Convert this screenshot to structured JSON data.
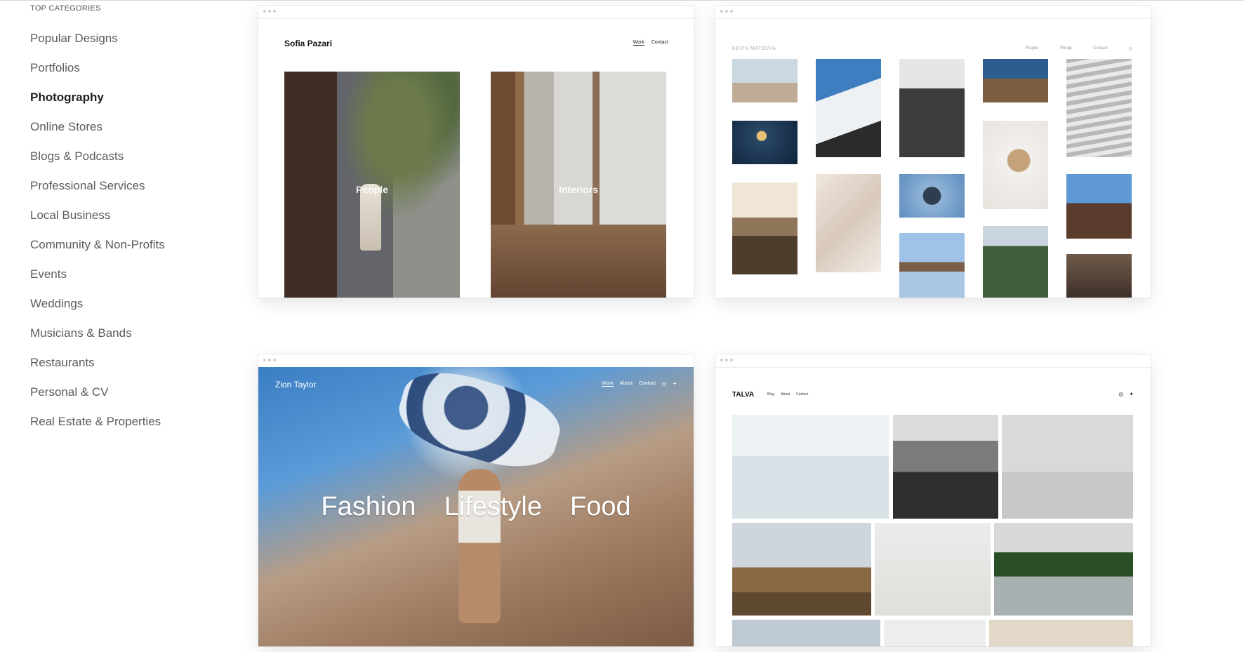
{
  "sidebar": {
    "heading": "TOP CATEGORIES",
    "active_index": 2,
    "items": [
      {
        "label": "Popular Designs"
      },
      {
        "label": "Portfolios"
      },
      {
        "label": "Photography"
      },
      {
        "label": "Online Stores"
      },
      {
        "label": "Blogs & Podcasts"
      },
      {
        "label": "Professional Services"
      },
      {
        "label": "Local Business"
      },
      {
        "label": "Community & Non-Profits"
      },
      {
        "label": "Events"
      },
      {
        "label": "Weddings"
      },
      {
        "label": "Musicians & Bands"
      },
      {
        "label": "Restaurants"
      },
      {
        "label": "Personal & CV"
      },
      {
        "label": "Real Estate & Properties"
      }
    ]
  },
  "templates": [
    {
      "brand": "Sofia Pazari",
      "nav": [
        "Work",
        "Contact"
      ],
      "tiles": [
        "People",
        "Interiors"
      ]
    },
    {
      "brand": "KEVIN MATSUYA",
      "nav": [
        "People",
        "Things",
        "Contact"
      ],
      "icon": "instagram-icon"
    },
    {
      "brand": "Zion Taylor",
      "nav": [
        "Work",
        "About",
        "Contact"
      ],
      "icons": [
        "instagram-icon",
        "twitter-icon"
      ],
      "headline": [
        "Fashion",
        "Lifestyle",
        "Food"
      ]
    },
    {
      "brand": "TALVA",
      "nav": [
        "Blog",
        "About",
        "Contact"
      ],
      "icons": [
        "instagram-icon",
        "twitter-icon"
      ]
    }
  ]
}
